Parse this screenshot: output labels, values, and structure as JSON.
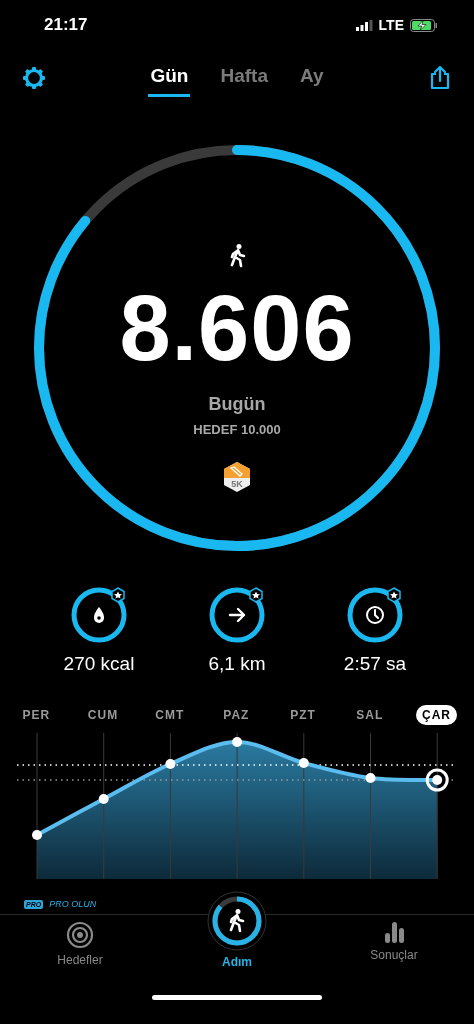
{
  "status_bar": {
    "time": "21:17",
    "network": "LTE"
  },
  "header": {
    "tabs": [
      {
        "label": "Gün",
        "selected": true
      },
      {
        "label": "Hafta",
        "selected": false
      },
      {
        "label": "Ay",
        "selected": false
      }
    ]
  },
  "progress": {
    "level": 0.8606,
    "steps": "8.606",
    "day": "Bugün",
    "goal": "HEDEF 10.000",
    "badge": "5K"
  },
  "stats": [
    {
      "kind": "calories",
      "value": "270 kcal",
      "achieved": true
    },
    {
      "kind": "distance",
      "value": "6,1 km",
      "achieved": true
    },
    {
      "kind": "time",
      "value": "2:57 sa",
      "achieved": true
    }
  ],
  "week_chart": {
    "days": [
      {
        "label": "PER",
        "selected": false
      },
      {
        "label": "CUM",
        "selected": false
      },
      {
        "label": "CMT",
        "selected": false
      },
      {
        "label": "PAZ",
        "selected": false
      },
      {
        "label": "PZT",
        "selected": false
      },
      {
        "label": "SAL",
        "selected": false
      },
      {
        "label": "ÇAR",
        "selected": true
      }
    ]
  },
  "pro": {
    "badge": "PRO",
    "label": "PRO OLUN"
  },
  "nav": [
    {
      "kind": "goals",
      "label": "Hedefler",
      "selected": false
    },
    {
      "kind": "steps",
      "label": "Adım",
      "selected": true
    },
    {
      "kind": "results",
      "label": "Sonuçlar",
      "selected": false
    }
  ]
}
